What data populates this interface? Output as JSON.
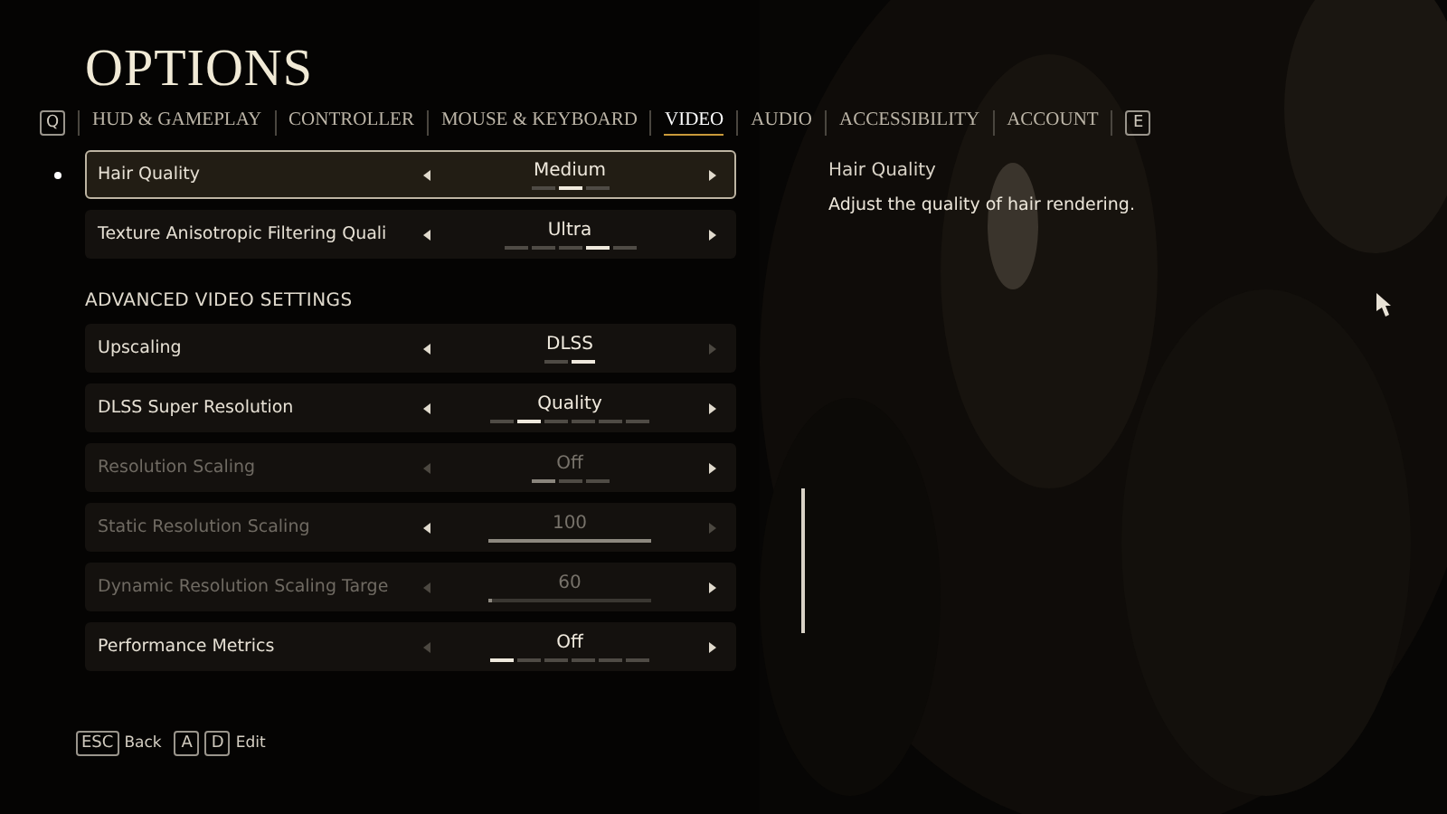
{
  "title": "OPTIONS",
  "tabs": [
    {
      "label": "HUD & GAMEPLAY",
      "selected": false
    },
    {
      "label": "CONTROLLER",
      "selected": false
    },
    {
      "label": "MOUSE & KEYBOARD",
      "selected": false
    },
    {
      "label": "VIDEO",
      "selected": true
    },
    {
      "label": "AUDIO",
      "selected": false
    },
    {
      "label": "ACCESSIBILITY",
      "selected": false
    },
    {
      "label": "ACCOUNT",
      "selected": false
    }
  ],
  "tab_keys": {
    "prev": "Q",
    "next": "E"
  },
  "settings": [
    {
      "kind": "steps",
      "label": "Hair Quality",
      "value": "Medium",
      "selected": true,
      "disabled": false,
      "left_enabled": true,
      "right_enabled": true,
      "steps": [
        {
          "on": false
        },
        {
          "on": true
        },
        {
          "on": false
        }
      ]
    },
    {
      "kind": "steps",
      "label": "Texture Anisotropic Filtering Quali",
      "value": "Ultra",
      "selected": false,
      "disabled": false,
      "left_enabled": true,
      "right_enabled": true,
      "steps": [
        {
          "on": false
        },
        {
          "on": false
        },
        {
          "on": false
        },
        {
          "on": true
        },
        {
          "on": false
        }
      ]
    }
  ],
  "section_heading": "ADVANCED VIDEO SETTINGS",
  "advanced_settings": [
    {
      "kind": "steps",
      "label": "Upscaling",
      "value": "DLSS",
      "selected": false,
      "disabled": false,
      "left_enabled": true,
      "right_enabled": false,
      "steps": [
        {
          "on": false
        },
        {
          "on": true
        }
      ]
    },
    {
      "kind": "steps",
      "label": "DLSS Super Resolution",
      "value": "Quality",
      "selected": false,
      "disabled": false,
      "left_enabled": true,
      "right_enabled": true,
      "steps": [
        {
          "on": false
        },
        {
          "on": true
        },
        {
          "on": false
        },
        {
          "on": false
        },
        {
          "on": false
        },
        {
          "on": false
        }
      ]
    },
    {
      "kind": "steps",
      "label": "Resolution Scaling",
      "value": "Off",
      "selected": false,
      "disabled": true,
      "left_enabled": false,
      "right_enabled": true,
      "steps": [
        {
          "on": true
        },
        {
          "on": false
        },
        {
          "on": false
        }
      ]
    },
    {
      "kind": "slider",
      "label": "Static Resolution Scaling",
      "value": "100",
      "selected": false,
      "disabled": true,
      "left_enabled": true,
      "right_enabled": false,
      "level": 1
    },
    {
      "kind": "slider",
      "label": "Dynamic Resolution Scaling Targe",
      "value": "60",
      "selected": false,
      "disabled": true,
      "left_enabled": false,
      "right_enabled": true,
      "level": 0.02
    },
    {
      "kind": "steps",
      "label": "Performance Metrics",
      "value": "Off",
      "selected": false,
      "disabled": false,
      "left_enabled": false,
      "right_enabled": true,
      "steps": [
        {
          "on": true
        },
        {
          "on": false
        },
        {
          "on": false
        },
        {
          "on": false
        },
        {
          "on": false
        },
        {
          "on": false
        }
      ]
    }
  ],
  "description": {
    "title": "Hair Quality",
    "text": "Adjust the quality of hair rendering."
  },
  "footer": [
    {
      "keys": [
        "ESC"
      ],
      "label": "Back"
    },
    {
      "keys": [
        "A",
        "D"
      ],
      "label": "Edit"
    }
  ]
}
